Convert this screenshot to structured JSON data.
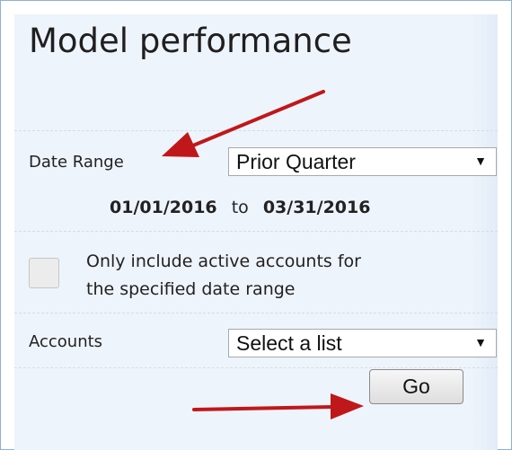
{
  "title": "Model performance",
  "date_range": {
    "label": "Date Range",
    "selected": "Prior Quarter",
    "start": "01/01/2016",
    "separator": "to",
    "end": "03/31/2016"
  },
  "active_accounts": {
    "checked": false,
    "line1": "Only include active accounts for",
    "line2": "the specified date range"
  },
  "accounts": {
    "label": "Accounts",
    "selected": "Select a list"
  },
  "go_label": "Go",
  "caret_glyph": "▼",
  "annotation_color": "#c0171b"
}
